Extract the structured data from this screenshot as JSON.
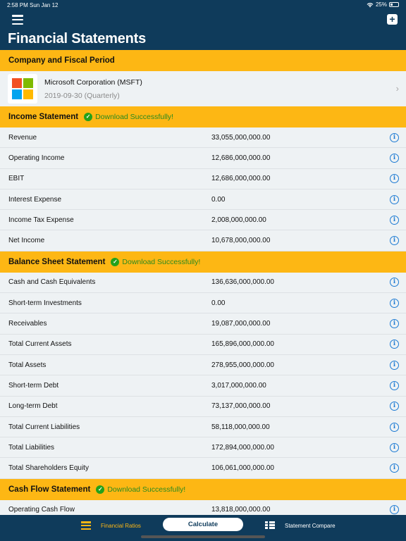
{
  "status_bar": {
    "time": "2:58 PM",
    "date": "Sun Jan 12",
    "battery": "25%",
    "battery_level": 0.25
  },
  "header": {
    "title": "Financial Statements",
    "menu_icon": "hamburger-icon",
    "add_icon": "plus-square-icon"
  },
  "company_section": {
    "title": "Company and Fiscal Period",
    "company_name": "Microsoft Corporation (MSFT)",
    "period": "2019-09-30 (Quarterly)",
    "logo_colors": [
      "#f25022",
      "#7fba00",
      "#00a4ef",
      "#ffb900"
    ]
  },
  "income_statement": {
    "title": "Income Statement",
    "status": "Download Successfully!",
    "rows": [
      {
        "label": "Revenue",
        "value": "33,055,000,000.00"
      },
      {
        "label": "Operating Income",
        "value": "12,686,000,000.00"
      },
      {
        "label": "EBIT",
        "value": "12,686,000,000.00"
      },
      {
        "label": "Interest Expense",
        "value": "0.00"
      },
      {
        "label": "Income Tax Expense",
        "value": "2,008,000,000.00"
      },
      {
        "label": "Net Income",
        "value": "10,678,000,000.00"
      }
    ]
  },
  "balance_sheet": {
    "title": "Balance Sheet Statement",
    "status": "Download Successfully!",
    "rows": [
      {
        "label": "Cash and Cash Equivalents",
        "value": "136,636,000,000.00"
      },
      {
        "label": "Short-term Investments",
        "value": "0.00"
      },
      {
        "label": "Receivables",
        "value": "19,087,000,000.00"
      },
      {
        "label": "Total Current Assets",
        "value": "165,896,000,000.00"
      },
      {
        "label": "Total Assets",
        "value": "278,955,000,000.00"
      },
      {
        "label": "Short-term Debt",
        "value": "3,017,000,000.00"
      },
      {
        "label": "Long-term Debt",
        "value": "73,137,000,000.00"
      },
      {
        "label": "Total Current Liabilities",
        "value": "58,118,000,000.00"
      },
      {
        "label": "Total Liabilities",
        "value": "172,894,000,000.00"
      },
      {
        "label": "Total Shareholders Equity",
        "value": "106,061,000,000.00"
      }
    ]
  },
  "cash_flow": {
    "title": "Cash Flow Statement",
    "status": "Download Successfully!",
    "rows": [
      {
        "label": "Operating Cash Flow",
        "value": "13,818,000,000.00"
      }
    ]
  },
  "tab_bar": {
    "left_label": "Financial Ratios",
    "center_label": "Calculate",
    "right_label": "Statement Compare"
  },
  "colors": {
    "navy": "#0f3b5b",
    "accent": "#fdb714",
    "success": "#24a11b",
    "info": "#1c7ad3"
  }
}
